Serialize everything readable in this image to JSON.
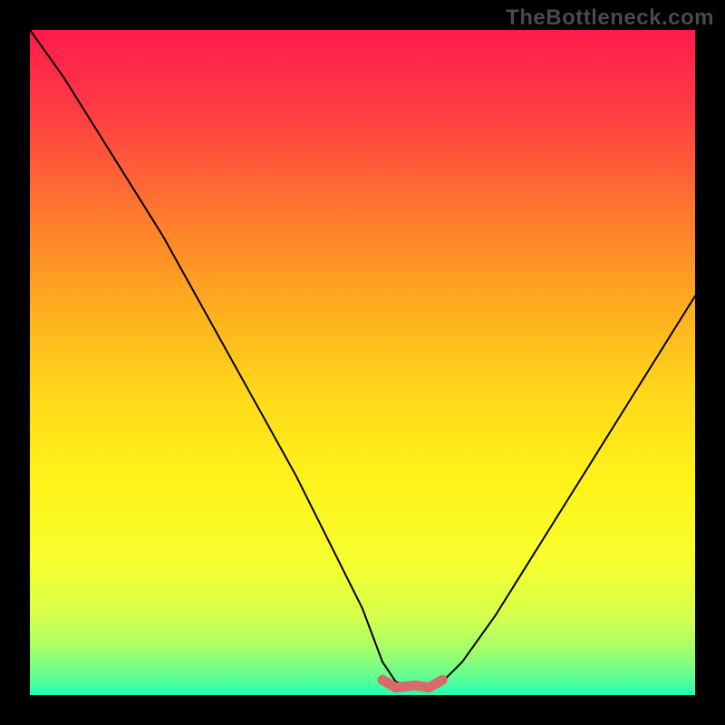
{
  "watermark": "TheBottleneck.com",
  "colors": {
    "page_background": "#000000",
    "curve_stroke": "#000000",
    "optimal_marker": "#d86a6a",
    "watermark_text": "#4a4a4a",
    "gradient_stops": [
      {
        "offset": 0.0,
        "color": "#ff1b4c"
      },
      {
        "offset": 0.12,
        "color": "#ff3b43"
      },
      {
        "offset": 0.28,
        "color": "#ff7a2e"
      },
      {
        "offset": 0.42,
        "color": "#ffae1f"
      },
      {
        "offset": 0.55,
        "color": "#ffd91a"
      },
      {
        "offset": 0.68,
        "color": "#fff31a"
      },
      {
        "offset": 0.8,
        "color": "#f6ff2e"
      },
      {
        "offset": 0.88,
        "color": "#d7ff4d"
      },
      {
        "offset": 0.93,
        "color": "#a6ff6a"
      },
      {
        "offset": 0.97,
        "color": "#66ff8f"
      },
      {
        "offset": 1.0,
        "color": "#22ffb4"
      }
    ]
  },
  "chart_data": {
    "type": "line",
    "title": "",
    "xlabel": "",
    "ylabel": "",
    "xlim": [
      0,
      100
    ],
    "ylim": [
      0,
      100
    ],
    "series": [
      {
        "name": "bottleneck_curve",
        "x": [
          0,
          5,
          10,
          15,
          20,
          25,
          30,
          35,
          40,
          45,
          50,
          53,
          55,
          58,
          60,
          62,
          65,
          70,
          75,
          80,
          85,
          90,
          95,
          100
        ],
        "values": [
          100,
          93,
          85,
          77,
          69,
          60,
          51,
          42,
          33,
          23,
          13,
          5,
          2,
          1,
          1,
          2,
          5,
          12,
          20,
          28,
          36,
          44,
          52,
          60
        ]
      },
      {
        "name": "optimal_zone",
        "x": [
          53,
          55,
          58,
          60,
          62
        ],
        "values": [
          2.0,
          1.4,
          1.2,
          1.4,
          2.0
        ]
      }
    ],
    "annotations": []
  }
}
